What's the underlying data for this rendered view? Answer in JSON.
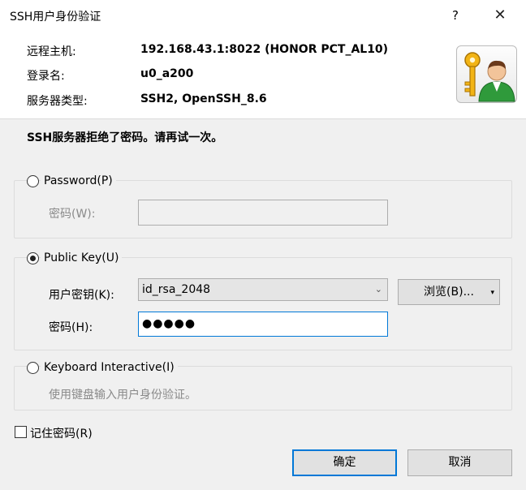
{
  "window": {
    "title": "SSH用户身份验证",
    "help_label": "?",
    "close_label": "✕"
  },
  "info": {
    "host_label": "远程主机:",
    "host_value": "192.168.43.1:8022 (HONOR PCT_AL10)",
    "login_label": "登录名:",
    "login_value": "u0_a200",
    "server_type_label": "服务器类型:",
    "server_type_value": "SSH2, OpenSSH_8.6"
  },
  "avatar": {
    "icon": "key-user-icon"
  },
  "status_message": "SSH服务器拒绝了密码。请再试一次。",
  "password_section": {
    "radio_label": "Password(P)",
    "checked": false,
    "field_label": "密码(W):",
    "value": ""
  },
  "pubkey_section": {
    "radio_label": "Public Key(U)",
    "checked": true,
    "key_label": "用户密钥(K):",
    "key_value": "id_rsa_2048",
    "browse_label": "浏览(B)...",
    "passphrase_label": "密码(H):",
    "passphrase_masked": "●●●●●"
  },
  "keyboard_section": {
    "radio_label": "Keyboard Interactive(I)",
    "checked": false,
    "description": "使用键盘输入用户身份验证。"
  },
  "remember_password": {
    "label": "记住密码(R)",
    "checked": false
  },
  "buttons": {
    "ok_label": "确定",
    "cancel_label": "取消"
  },
  "colors": {
    "accent": "#0078d7",
    "dialog_bg": "#f0f0f0"
  }
}
